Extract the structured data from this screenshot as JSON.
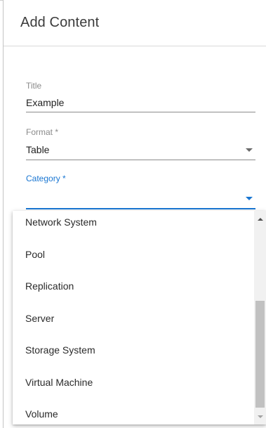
{
  "dialog": {
    "title": "Add Content"
  },
  "form": {
    "title_field": {
      "label": "Title",
      "value": "Example"
    },
    "format_field": {
      "label": "Format *",
      "value": "Table"
    },
    "category_field": {
      "label": "Category *",
      "value": ""
    }
  },
  "dropdown": {
    "options": [
      "Network System",
      "Pool",
      "Replication",
      "Server",
      "Storage System",
      "Virtual Machine",
      "Volume"
    ]
  },
  "colors": {
    "accent": "#1976d2",
    "text": "#222222",
    "label": "#8a8a8a"
  }
}
